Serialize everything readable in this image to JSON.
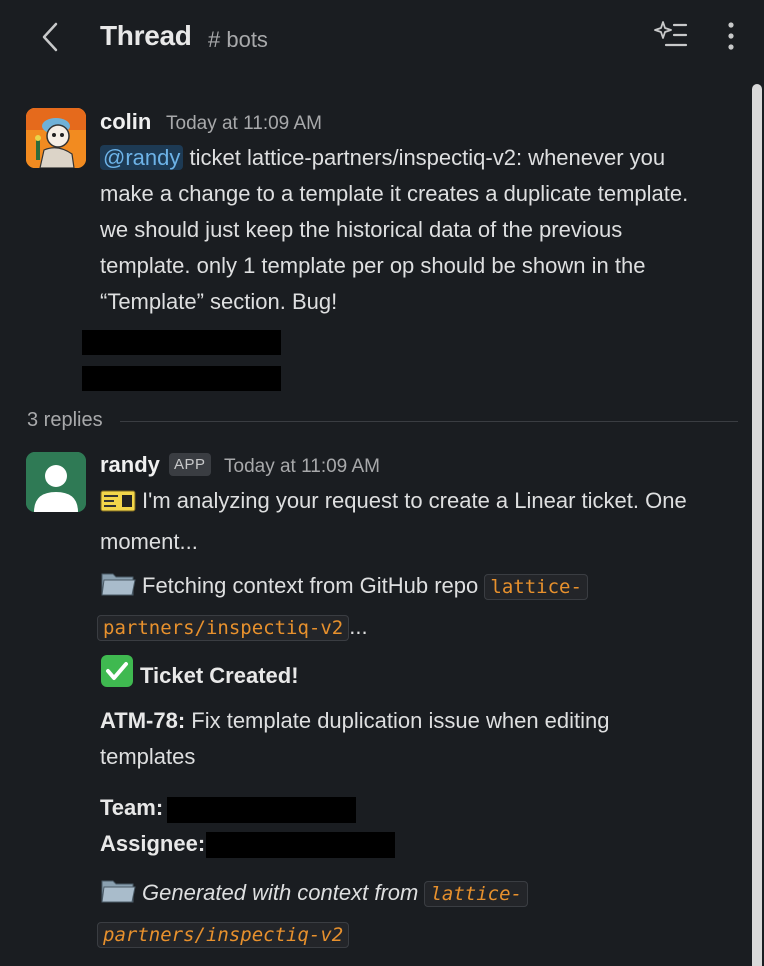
{
  "header": {
    "title": "Thread",
    "channel": "# bots"
  },
  "parent": {
    "author": "colin",
    "time": "Today at 11:09 AM",
    "mention": "@randy",
    "line1_rest": " ticket lattice-partners/inspectiq-v2: whenever you",
    "line2": "make a change to a template it creates a duplicate template.",
    "line3": "we should just keep the historical data of the previous",
    "line4": "template. only 1 template per op should be shown in the",
    "line5": "“Template” section. Bug!"
  },
  "replies_label": "3 replies",
  "reply": {
    "author": "randy",
    "badge": "APP",
    "time": "Today at 11:09 AM",
    "analyzing_line1": "I'm analyzing your request to create a Linear ticket. One",
    "analyzing_line2": "moment...",
    "fetching_text": "Fetching context from GitHub repo ",
    "repo_code_part1": "lattice-",
    "repo_code_part2": "partners/inspectiq-v2",
    "ellipsis": "...",
    "created_text": "Ticket Created!",
    "ticket_id": "ATM-78:",
    "ticket_title_line1": " Fix template duplication issue when editing",
    "ticket_title_line2": "templates",
    "team_label": "Team:",
    "assignee_label": "Assignee:",
    "generated_text": "Generated with context from ",
    "gen_code_part1": "lattice-",
    "gen_code_part2": "partners/inspectiq-v2"
  },
  "colors": {
    "background": "#1a1d21",
    "mention": "#6db3e8",
    "code": "#e8912d",
    "check": "#3fb950"
  }
}
